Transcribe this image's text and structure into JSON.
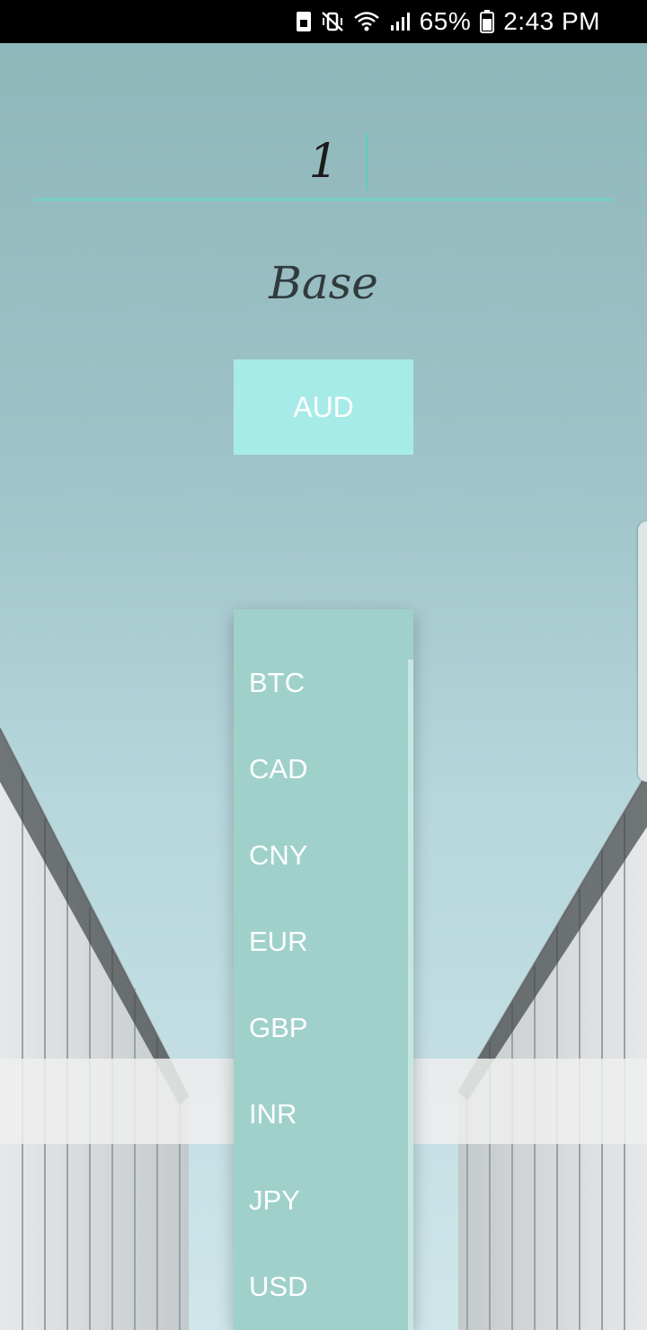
{
  "status_bar": {
    "battery_percent": "65%",
    "time": "2:43 PM",
    "icons": [
      "sim-icon",
      "vibrate-mute-icon",
      "wifi-icon",
      "signal-icon",
      "battery-icon"
    ]
  },
  "amount": {
    "value": "1"
  },
  "base": {
    "label": "Base",
    "selected_currency": "AUD"
  },
  "dropdown": {
    "options": [
      "BTC",
      "CAD",
      "CNY",
      "EUR",
      "GBP",
      "INR",
      "JPY",
      "USD"
    ]
  },
  "colors": {
    "accent": "#7ccdc6",
    "button": "#a7ebe9",
    "dropdown": "#9fd1ca",
    "status_bar": "#000000"
  }
}
